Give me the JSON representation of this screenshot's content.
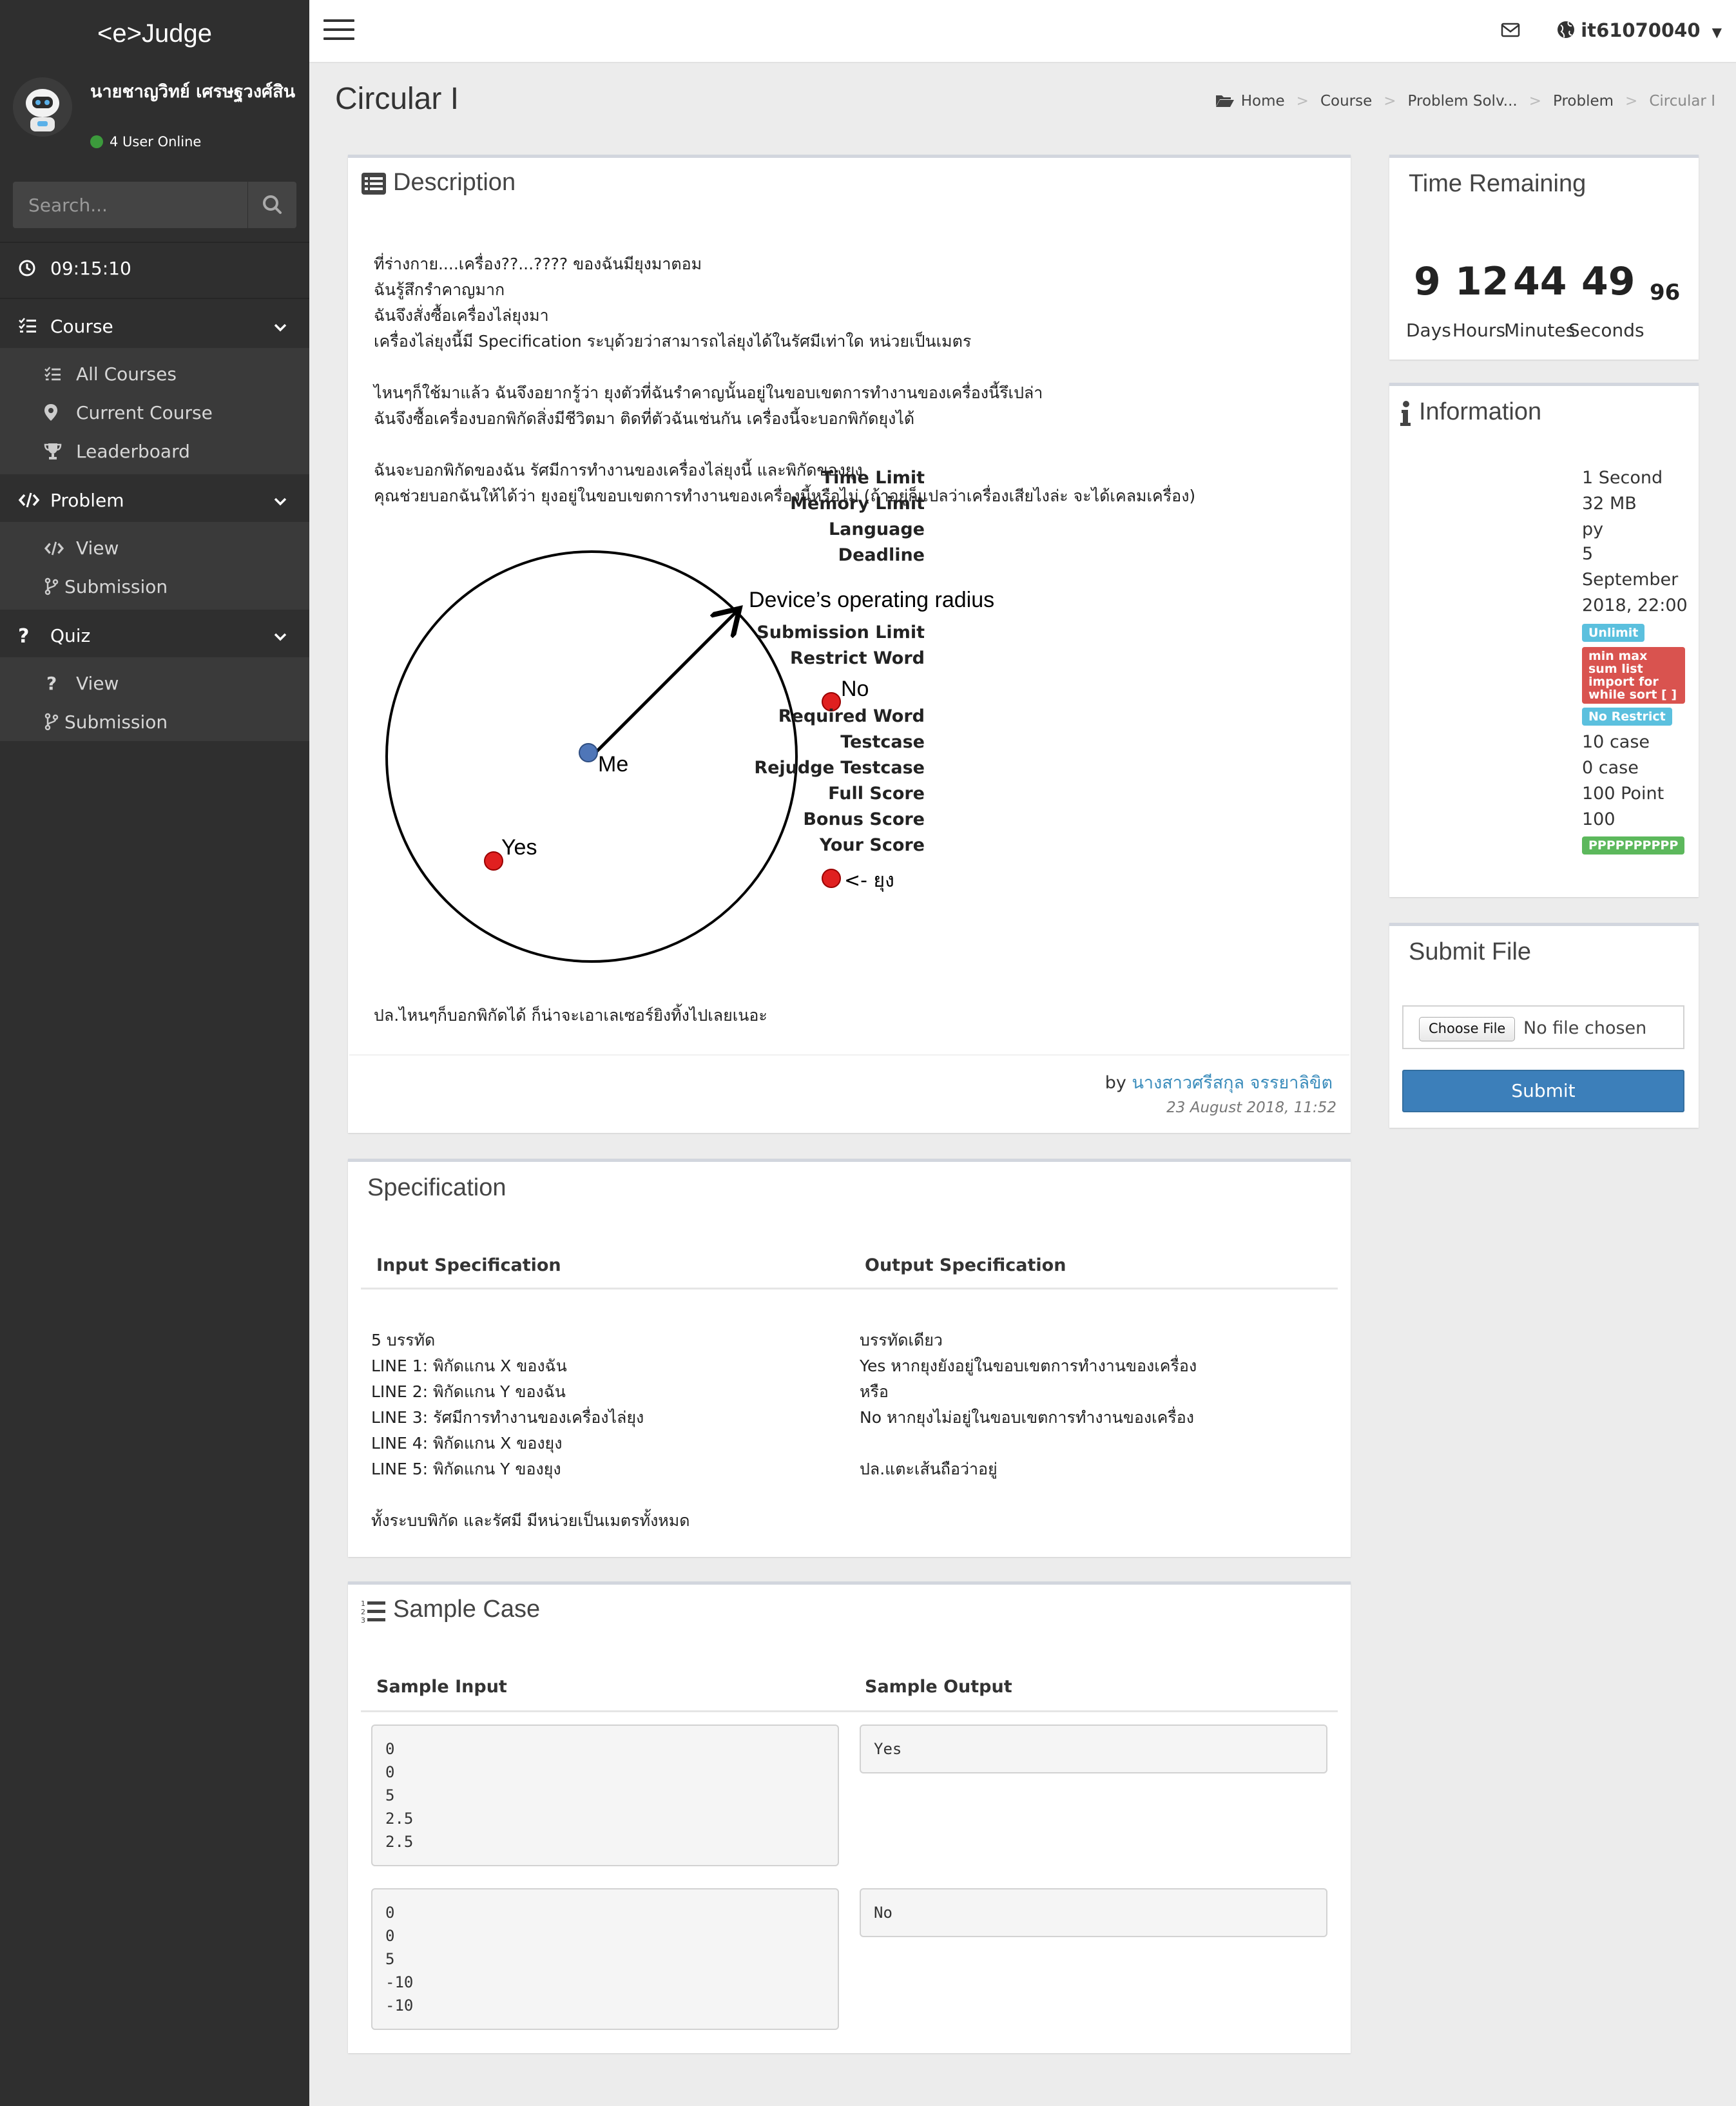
{
  "brand": "<e>Judge",
  "user": {
    "name": "นายชาญวิทย์ เศรษฐวงศ์สิน",
    "online": "4 User Online"
  },
  "search": {
    "placeholder": "Search..."
  },
  "clock": "09:15:10",
  "sidebar": {
    "course": {
      "label": "Course",
      "items": [
        "All Courses",
        "Current Course",
        "Leaderboard"
      ]
    },
    "problem": {
      "label": "Problem",
      "items": [
        "View",
        "Submission"
      ]
    },
    "quiz": {
      "label": "Quiz",
      "items": [
        "View",
        "Submission"
      ]
    }
  },
  "topbar": {
    "username": "it61070040"
  },
  "page": {
    "title": "Circular I"
  },
  "breadcrumb": [
    "Home",
    "Course",
    "Problem Solv...",
    "Problem",
    "Circular I"
  ],
  "description": {
    "heading": "Description",
    "paragraph1": [
      "ที่ร่างกาย....เครื่อง??...???? ของฉันมียุงมาตอม",
      "ฉันรู้สึกรำคาญมาก",
      "ฉันจึงสั่งซื้อเครื่องไล่ยุงมา",
      "เครื่องไล่ยุงนี้มี Specification ระบุด้วยว่าสามารถไล่ยุงได้ในรัศมีเท่าใด หน่วยเป็นเมตร"
    ],
    "paragraph2": [
      "ไหนๆก็ใช้มาแล้ว ฉันจึงอยากรู้ว่า ยุงตัวที่ฉันรำคาญนั้นอยู่ในขอบเขตการทำงานของเครื่องนี้รึเปล่า",
      "ฉันจึงซื้อเครื่องบอกพิกัดสิ่งมีชีวิตมา ติดที่ตัวฉันเช่นกัน เครื่องนี้จะบอกพิกัดยุงได้"
    ],
    "paragraph3": [
      "ฉันจะบอกพิกัดของฉัน รัศมีการทำงานของเครื่องไล่ยุงนี้ และพิกัดของยุง",
      "คุณช่วยบอกฉันให้ได้ว่า ยุงอยู่ในขอบเขตการทำงานของเครื่องนี้หรือไม่ (ถ้าอยู่ก็แปลว่าเครื่องเสียไงล่ะ จะได้เคลมเครื่อง)"
    ],
    "diagram": {
      "radius_label": "Device’s operating radius",
      "me": "Me",
      "yes": "Yes",
      "no": "No",
      "mosquito": "<- ยุง"
    },
    "footnote": "ปล.ไหนๆก็บอกพิกัดได้ ก็น่าจะเอาเลเซอร์ยิงทิ้งไปเลยเนอะ",
    "by": "by",
    "author": "นางสาวศรีสกุล จรรยาลิขิต",
    "posted": "23 August 2018, 11:52"
  },
  "specification": {
    "heading": "Specification",
    "input_head": "Input Specification",
    "output_head": "Output Specification",
    "input_lines": [
      "5 บรรทัด",
      "LINE 1: พิกัดแกน X ของฉัน",
      "LINE 2: พิกัดแกน Y ของฉัน",
      "LINE 3: รัศมีการทำงานของเครื่องไล่ยุง",
      "LINE 4: พิกัดแกน X ของยุง",
      "LINE 5: พิกัดแกน Y ของยุง"
    ],
    "input_note": "ทั้งระบบพิกัด และรัศมี มีหน่วยเป็นเมตรทั้งหมด",
    "output_lines": [
      "บรรทัดเดียว",
      "Yes หากยุงยังอยู่ในขอบเขตการทำงานของเครื่อง",
      "หรือ",
      "No หากยุงไม่อยู่ในขอบเขตการทำงานของเครื่อง"
    ],
    "output_note": "ปล.แตะเส้นถือว่าอยู่"
  },
  "samples": {
    "heading": "Sample Case",
    "input_head": "Sample Input",
    "output_head": "Sample Output",
    "cases": [
      {
        "input": "0\n0\n5\n2.5\n2.5",
        "output": "Yes"
      },
      {
        "input": "0\n0\n5\n-10\n-10",
        "output": "No"
      }
    ]
  },
  "time_remaining": {
    "heading": "Time Remaining",
    "days": "9",
    "hours": "12",
    "minutes": "44",
    "seconds": "49",
    "sub": "96",
    "labels": [
      "Days",
      "Hours",
      "Minutes",
      "Seconds"
    ]
  },
  "information": {
    "heading": "Information",
    "time_limit": {
      "label": "Time Limit",
      "value": "1 Second"
    },
    "memory_limit": {
      "label": "Memory Limit",
      "value": "32 MB"
    },
    "language": {
      "label": "Language",
      "value": "py"
    },
    "deadline": {
      "label": "Deadline",
      "value_lines": [
        "5",
        "September",
        "2018, 22:00"
      ]
    },
    "submission_limit": {
      "label": "Submission Limit",
      "badge": "Unlimit"
    },
    "restrict_word": {
      "label": "Restrict Word",
      "badge_lines": [
        "min max",
        "sum list",
        "import for",
        "while sort [ ]"
      ]
    },
    "required_word": {
      "label": "Required Word",
      "badge": "No Restrict"
    },
    "testcase": {
      "label": "Testcase",
      "value": "10 case"
    },
    "rejudge_testcase": {
      "label": "Rejudge Testcase",
      "value": "0 case"
    },
    "full_score": {
      "label": "Full Score",
      "value": "100 Point"
    },
    "bonus_score": {
      "label": "Bonus Score",
      "value": "100"
    },
    "your_score": {
      "label": "Your Score",
      "badge": "PPPPPPPPPP"
    },
    "colors": {
      "info": "#5bc0de",
      "danger": "#d9534f",
      "success": "#5cb85c"
    }
  },
  "submit_file": {
    "heading": "Submit File",
    "choose": "Choose File",
    "no_file": "No file chosen",
    "submit": "Submit"
  }
}
